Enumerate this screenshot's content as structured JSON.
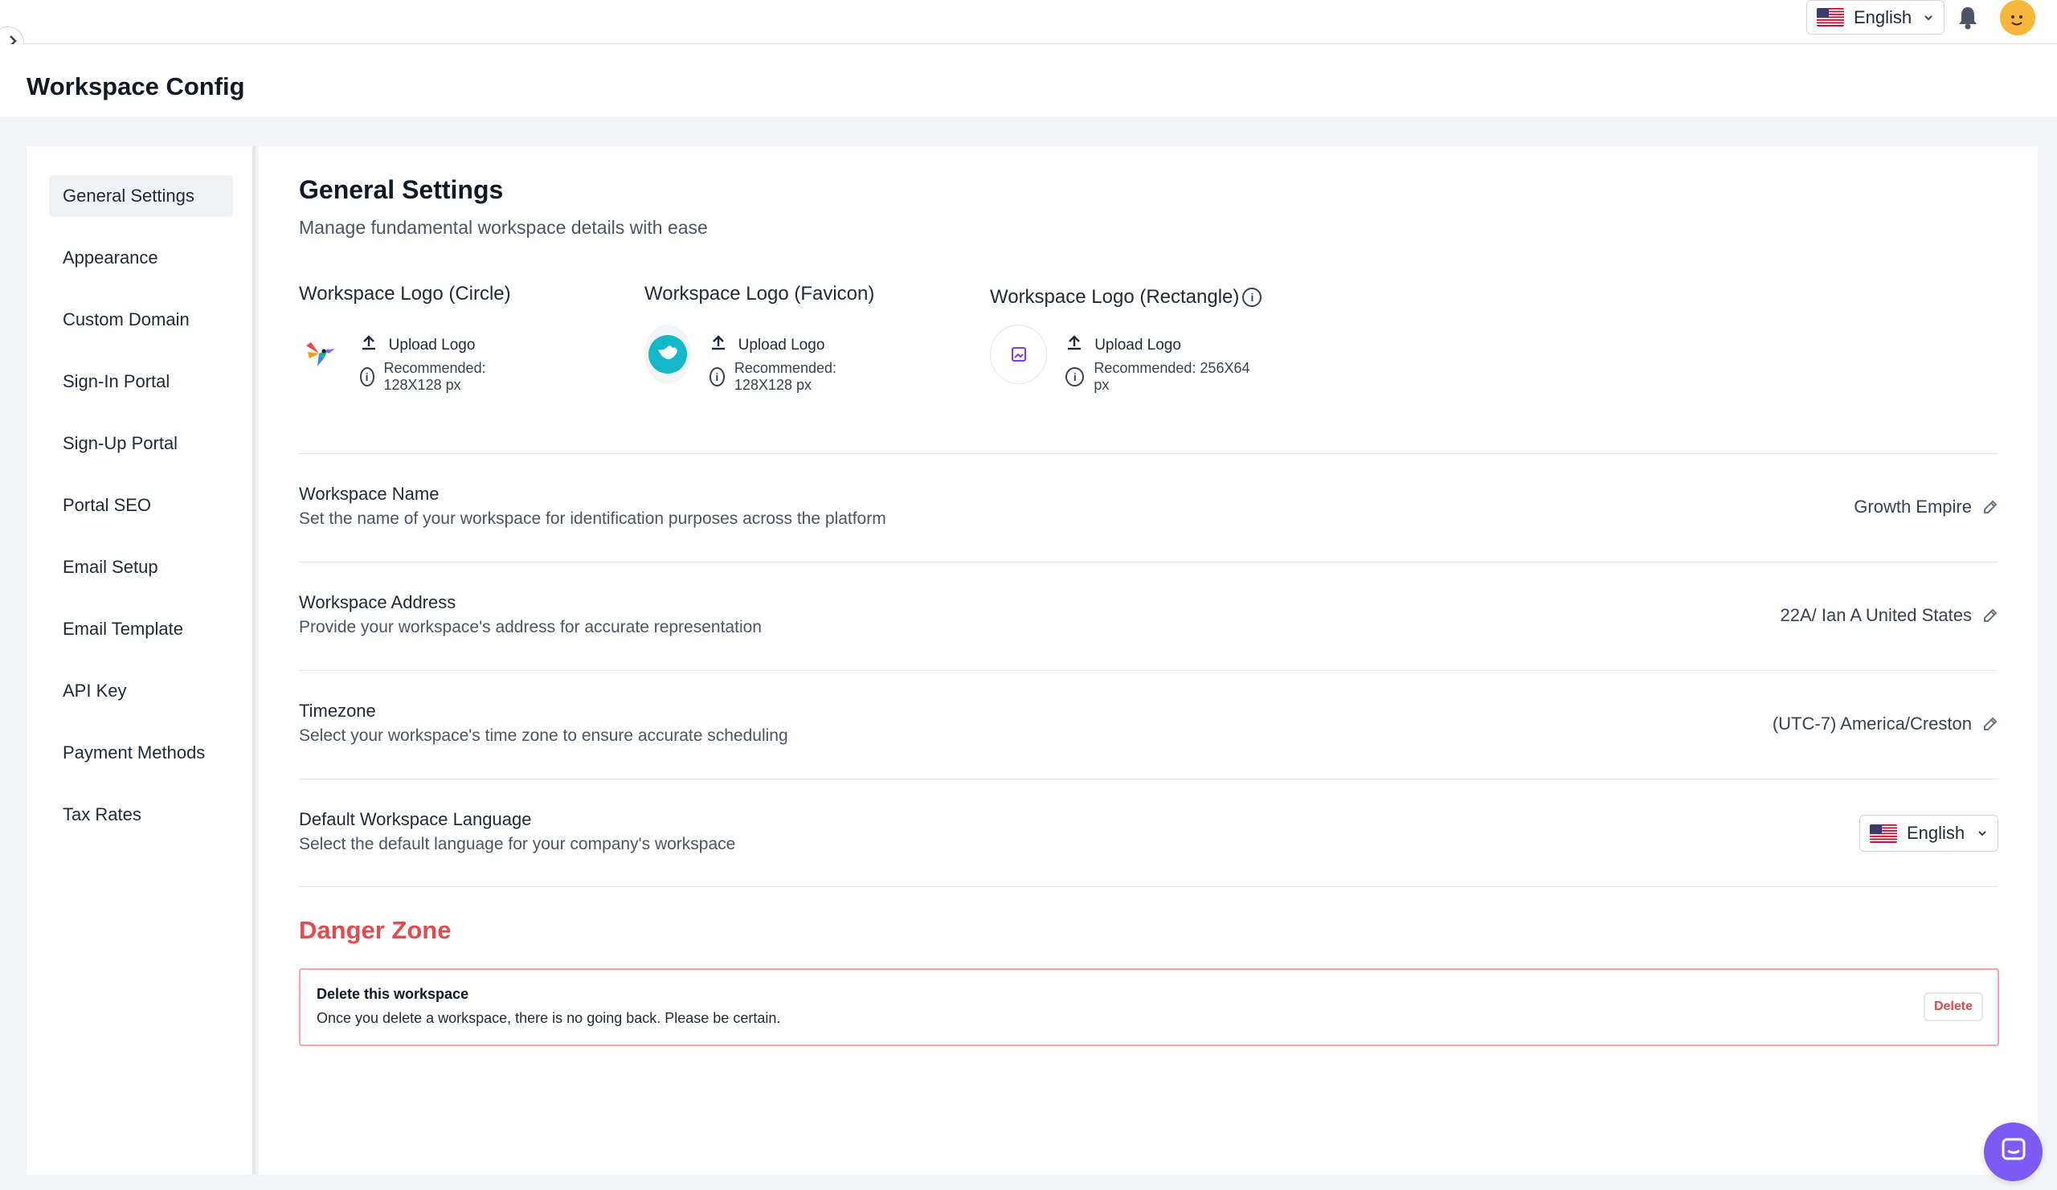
{
  "page_title": "Workspace Config",
  "header": {
    "language": "English"
  },
  "sidebar": {
    "items": [
      {
        "label": "General Settings",
        "active": true
      },
      {
        "label": "Appearance"
      },
      {
        "label": "Custom Domain"
      },
      {
        "label": "Sign-In Portal"
      },
      {
        "label": "Sign-Up Portal"
      },
      {
        "label": "Portal SEO"
      },
      {
        "label": "Email Setup"
      },
      {
        "label": "Email Template"
      },
      {
        "label": "API Key"
      },
      {
        "label": "Payment Methods"
      },
      {
        "label": "Tax Rates"
      }
    ]
  },
  "main": {
    "title": "General Settings",
    "subtitle": "Manage fundamental workspace details with ease",
    "logos": [
      {
        "label": "Workspace Logo (Circle)",
        "upload": "Upload Logo",
        "recommend": "Recommended: 128X128 px"
      },
      {
        "label": "Workspace Logo (Favicon)",
        "upload": "Upload Logo",
        "recommend": "Recommended: 128X128 px"
      },
      {
        "label": "Workspace Logo (Rectangle)",
        "upload": "Upload Logo",
        "recommend": "Recommended: 256X64 px"
      }
    ],
    "settings": [
      {
        "title": "Workspace Name",
        "desc": "Set the name of your workspace for identification purposes across the platform",
        "value": "Growth Empire"
      },
      {
        "title": "Workspace Address",
        "desc": "Provide your workspace's address for accurate representation",
        "value": "22A/ Ian A United States"
      },
      {
        "title": "Timezone",
        "desc": "Select your workspace's time zone to ensure accurate scheduling",
        "value": "(UTC-7) America/Creston"
      },
      {
        "title": "Default Workspace Language",
        "desc": "Select the default language for your company's workspace",
        "value": "English"
      }
    ],
    "danger": {
      "title": "Danger Zone",
      "heading": "Delete this workspace",
      "desc": "Once you delete a workspace, there is no going back. Please be certain.",
      "button": "Delete"
    }
  },
  "colors": {
    "accent": "#7c5cf5",
    "danger": "#e5484d",
    "favicon_teal": "#14b8c8"
  }
}
